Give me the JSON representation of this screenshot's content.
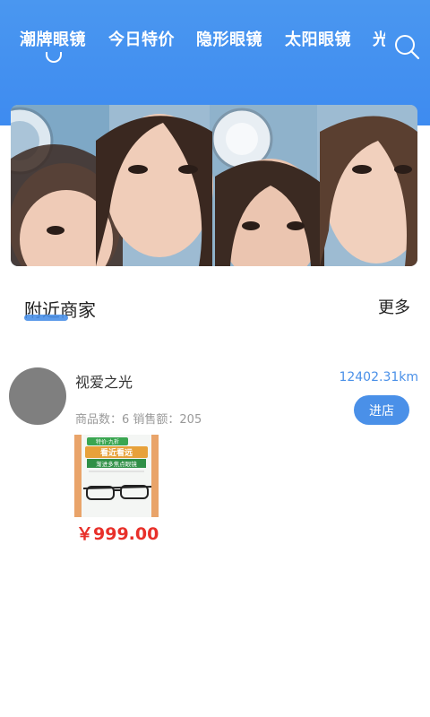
{
  "nav": {
    "tabs": [
      {
        "label": "潮牌眼镜"
      },
      {
        "label": "今日特价"
      },
      {
        "label": "隐形眼镜"
      },
      {
        "label": "太阳眼镜"
      },
      {
        "label": "光"
      }
    ],
    "search_icon": "search-icon"
  },
  "banner": {
    "description_icon": "banner-image"
  },
  "nearby": {
    "title": "附近商家",
    "more_label": "更多"
  },
  "store": {
    "name": "视爱之光",
    "distance": "12402.31km",
    "stats": "商品数：6 销售额：205",
    "enter_label": "进店",
    "product": {
      "price": "￥999.00",
      "promo_tag": "特价·九折",
      "promo_title": "看近看远",
      "promo_sub": "渐进多焦点眼镜"
    }
  },
  "colors": {
    "header": "#4a97f0",
    "accent": "#4a90e8",
    "price": "#e8302a"
  }
}
